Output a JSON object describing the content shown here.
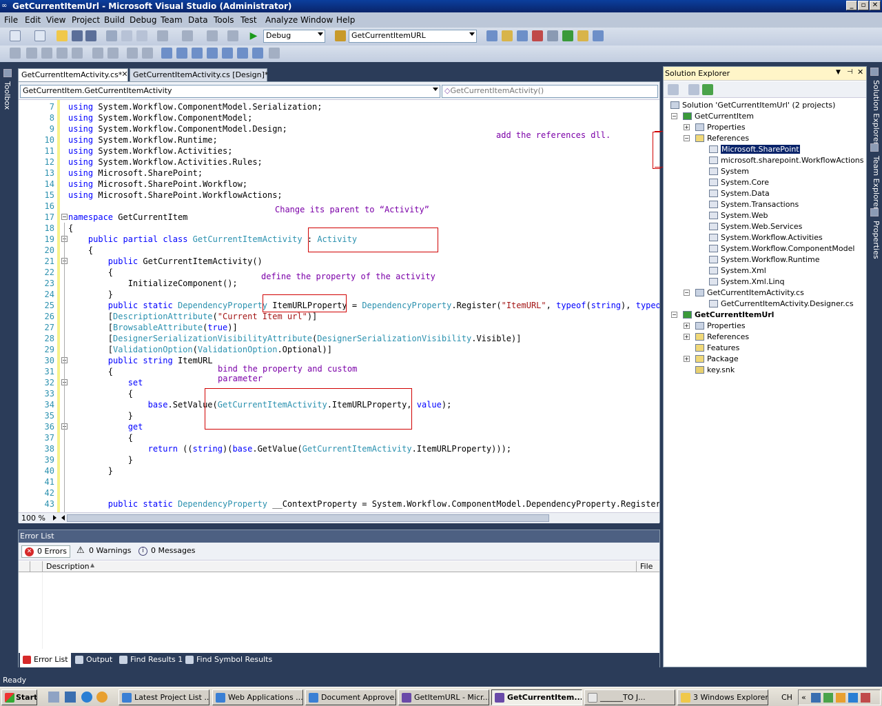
{
  "window": {
    "title": "GetCurrentItemUrl - Microsoft Visual Studio (Administrator)",
    "controls": [
      "_",
      "▫",
      "✕"
    ]
  },
  "menu": [
    "File",
    "Edit",
    "View",
    "Project",
    "Build",
    "Debug",
    "Team",
    "Data",
    "Tools",
    "Test",
    "Analyze",
    "Window",
    "Help"
  ],
  "toolbar": {
    "config": "Debug",
    "find_target": "GetCurrentItemURL"
  },
  "left_strip": {
    "label": "Toolbox"
  },
  "right_strip": {
    "labels": [
      "Solution Explorer",
      "Team Explorer",
      "Properties"
    ]
  },
  "doc_tabs": [
    {
      "label": "GetCurrentItemActivity.cs*",
      "active": true
    },
    {
      "label": "GetCurrentItemActivity.cs [Design]*",
      "active": false
    }
  ],
  "editor": {
    "type_selector": "GetCurrentItem.GetCurrentItemActivity",
    "member_selector": "GetCurrentItemActivity()",
    "zoom": "100 %",
    "lines": [
      {
        "n": "7",
        "code": "using System.Workflow.ComponentModel.Serialization;"
      },
      {
        "n": "8",
        "code": "using System.Workflow.ComponentModel;"
      },
      {
        "n": "9",
        "code": "using System.Workflow.ComponentModel.Design;"
      },
      {
        "n": "10",
        "code": "using System.Workflow.Runtime;"
      },
      {
        "n": "11",
        "code": "using System.Workflow.Activities;"
      },
      {
        "n": "12",
        "code": "using System.Workflow.Activities.Rules;"
      },
      {
        "n": "13",
        "code": "using Microsoft.SharePoint;"
      },
      {
        "n": "14",
        "code": "using Microsoft.SharePoint.Workflow;"
      },
      {
        "n": "15",
        "code": "using Microsoft.SharePoint.WorkflowActions;"
      },
      {
        "n": "16",
        "code": ""
      },
      {
        "n": "17",
        "code": "namespace GetCurrentItem"
      },
      {
        "n": "18",
        "code": "{"
      },
      {
        "n": "19",
        "code": "    public partial class GetCurrentItemActivity : Activity"
      },
      {
        "n": "20",
        "code": "    {"
      },
      {
        "n": "21",
        "code": "        public GetCurrentItemActivity()"
      },
      {
        "n": "22",
        "code": "        {"
      },
      {
        "n": "23",
        "code": "            InitializeComponent();"
      },
      {
        "n": "24",
        "code": "        }"
      },
      {
        "n": "25",
        "code": "        public static DependencyProperty ItemURLProperty = DependencyProperty.Register(\"ItemURL\", typeof(string), typeof(Ge"
      },
      {
        "n": "26",
        "code": "        [DescriptionAttribute(\"Current Item url\")]"
      },
      {
        "n": "27",
        "code": "        [BrowsableAttribute(true)]"
      },
      {
        "n": "28",
        "code": "        [DesignerSerializationVisibilityAttribute(DesignerSerializationVisibility.Visible)]"
      },
      {
        "n": "29",
        "code": "        [ValidationOption(ValidationOption.Optional)]"
      },
      {
        "n": "30",
        "code": "        public string ItemURL"
      },
      {
        "n": "31",
        "code": "        {"
      },
      {
        "n": "32",
        "code": "            set"
      },
      {
        "n": "33",
        "code": "            {"
      },
      {
        "n": "34",
        "code": "                base.SetValue(GetCurrentItemActivity.ItemURLProperty, value);"
      },
      {
        "n": "35",
        "code": "            }"
      },
      {
        "n": "36",
        "code": "            get"
      },
      {
        "n": "37",
        "code": "            {"
      },
      {
        "n": "38",
        "code": "                return ((string)(base.GetValue(GetCurrentItemActivity.ItemURLProperty)));"
      },
      {
        "n": "39",
        "code": "            }"
      },
      {
        "n": "40",
        "code": "        }"
      },
      {
        "n": "41",
        "code": ""
      },
      {
        "n": "42",
        "code": ""
      },
      {
        "n": "43",
        "code": "        public static DependencyProperty __ContextProperty = System.Workflow.ComponentModel.DependencyProperty.Register(\"_"
      }
    ],
    "annotations": {
      "parent": "Change its parent to “Activity”",
      "property": "define the property of the activity",
      "bind1": "bind the property and custom",
      "bind2": "parameter",
      "references": "add the references dll."
    }
  },
  "error_list": {
    "title": "Error List",
    "filters": {
      "errors": "0 Errors",
      "warnings": "0 Warnings",
      "messages": "0 Messages"
    },
    "columns": {
      "description": "Description",
      "file": "File"
    },
    "bottom_tabs": [
      "Error List",
      "Output",
      "Find Results 1",
      "Find Symbol Results"
    ]
  },
  "solution_explorer": {
    "title": "Solution Explorer",
    "solution": "Solution 'GetCurrentItemUrl' (2 projects)",
    "project1": "GetCurrentItem",
    "properties": "Properties",
    "references": "References",
    "refs": [
      "Microsoft.SharePoint",
      "microsoft.sharepoint.WorkflowActions",
      "System",
      "System.Core",
      "System.Data",
      "System.Transactions",
      "System.Web",
      "System.Web.Services",
      "System.Workflow.Activities",
      "System.Workflow.ComponentModel",
      "System.Workflow.Runtime",
      "System.Xml",
      "System.Xml.Linq"
    ],
    "activity_file": "GetCurrentItemActivity.cs",
    "designer_file": "GetCurrentItemActivity.Designer.cs",
    "project2": "GetCurrentItemUrl",
    "p2_items": [
      "Properties",
      "References",
      "Features",
      "Package",
      "key.snk"
    ]
  },
  "status": {
    "text": "Ready"
  },
  "taskbar": {
    "start": "Start",
    "items": [
      "Latest Project List ...",
      "Web Applications ...",
      "Document Approve...",
      "GetItemURL - Micr...",
      "GetCurrentItem...",
      "______TO J...",
      "3 Windows Explorer"
    ],
    "lang": "CH"
  },
  "colors": {
    "titlebar": "#0a246a",
    "frame": "#2b3c59",
    "keyword": "#0000ff",
    "type": "#2b91af",
    "string": "#a31515",
    "annotation": "#7b00a8",
    "highlight_box": "#d00000"
  }
}
